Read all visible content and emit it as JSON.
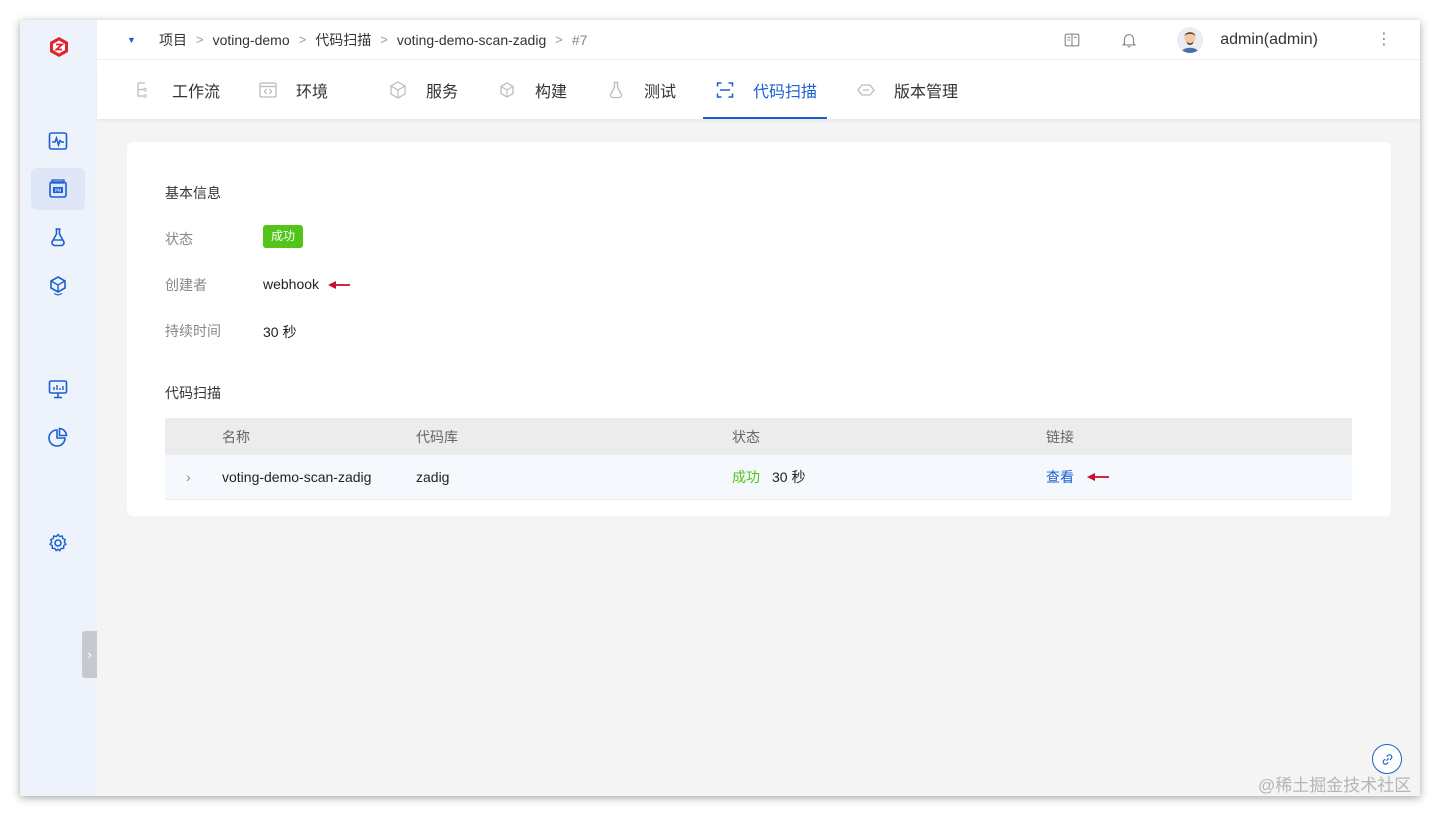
{
  "breadcrumb": {
    "items": [
      "项目",
      "voting-demo",
      "代码扫描",
      "voting-demo-scan-zadig",
      "#7"
    ],
    "separator": ">"
  },
  "header": {
    "user": "admin(admin)",
    "icons": [
      "doc-icon",
      "bell-icon",
      "more-vertical-icon"
    ]
  },
  "tabs": [
    {
      "label": "工作流",
      "icon": "workflow-icon"
    },
    {
      "label": "环境",
      "icon": "environment-icon"
    },
    {
      "label": "服务",
      "icon": "service-icon"
    },
    {
      "label": "构建",
      "icon": "build-icon"
    },
    {
      "label": "测试",
      "icon": "test-flask-icon"
    },
    {
      "label": "代码扫描",
      "icon": "scan-icon",
      "active": true
    },
    {
      "label": "版本管理",
      "icon": "version-icon"
    }
  ],
  "sidebar": {
    "items": [
      "pulse-monitor-icon",
      "project-pm-icon",
      "flask-icon",
      "cube-icon",
      "monitor-chart-icon",
      "pie-chart-icon",
      "settings-gear-icon"
    ],
    "active_index": 1,
    "collapse_label": "›"
  },
  "basic_info": {
    "title": "基本信息",
    "status_label": "状态",
    "status_value": "成功",
    "creator_label": "创建者",
    "creator_value": "webhook",
    "duration_label": "持续时间",
    "duration_value": "30 秒"
  },
  "scan_section": {
    "title": "代码扫描",
    "columns": [
      "名称",
      "代码库",
      "状态",
      "链接"
    ],
    "rows": [
      {
        "expand": "›",
        "name": "voting-demo-scan-zadig",
        "repo": "zadig",
        "status": "成功",
        "duration": "30 秒",
        "link": "查看"
      }
    ]
  },
  "watermark": "@稀土掘金技术社区",
  "colors": {
    "primary": "#1a5fd0",
    "success": "#52c41a",
    "brand_logo": "#e0252e",
    "annotation_arrow": "#c8102e"
  }
}
